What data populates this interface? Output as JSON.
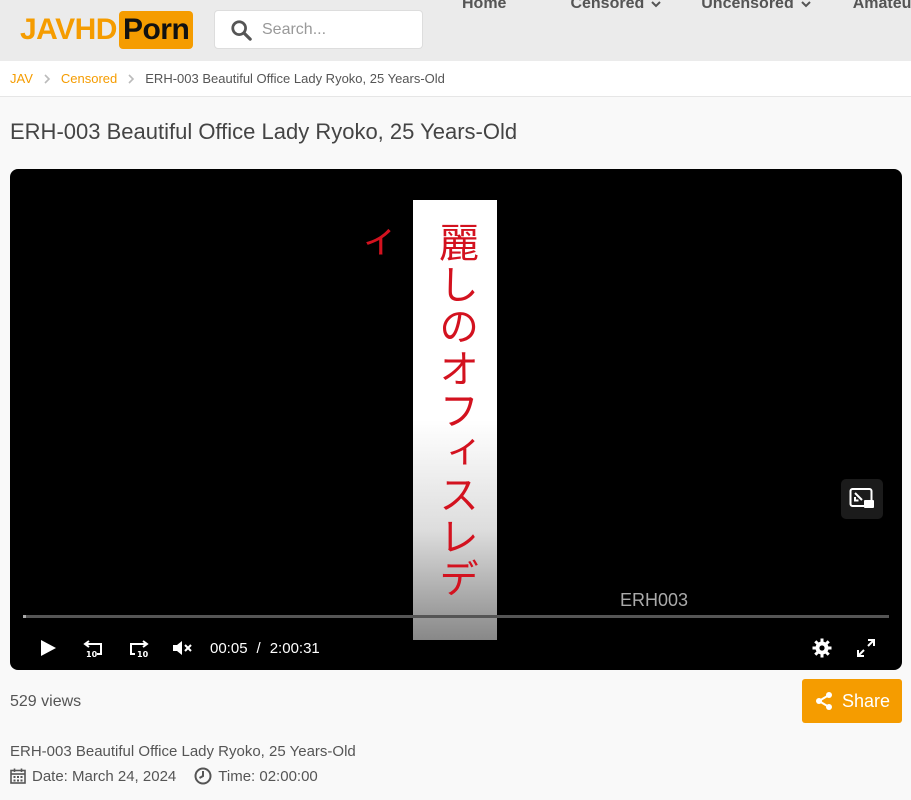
{
  "header": {
    "logo_part1": "JAVHD",
    "logo_part2": "Porn",
    "search_placeholder": "Search...",
    "nav": [
      {
        "label": "Home",
        "dropdown": false
      },
      {
        "label": "Censored",
        "dropdown": true
      },
      {
        "label": "Uncensored",
        "dropdown": true
      },
      {
        "label": "Amateur",
        "dropdown": false
      }
    ]
  },
  "breadcrumb": {
    "items": [
      "JAV",
      "Censored"
    ],
    "current": "ERH-003 Beautiful Office Lady Ryoko, 25 Years-Old"
  },
  "page": {
    "title": "ERH-003 Beautiful Office Lady Ryoko, 25 Years-Old"
  },
  "player": {
    "title_card_text": "麗しのオフィスレディ",
    "watermark": "ERH003",
    "current_time": "00:05",
    "duration": "2:00:31",
    "time_separator": "/",
    "progress": 0.004
  },
  "info": {
    "views": "529 views",
    "share_label": "Share",
    "description": "ERH-003 Beautiful Office Lady Ryoko, 25 Years-Old",
    "date": "Date: March 24, 2024",
    "time": "Time: 02:00:00"
  },
  "colors": {
    "accent": "#f59c00",
    "header_bg": "#ebebeb",
    "player_bg": "#000000",
    "title_card_text": "#d3121f"
  }
}
